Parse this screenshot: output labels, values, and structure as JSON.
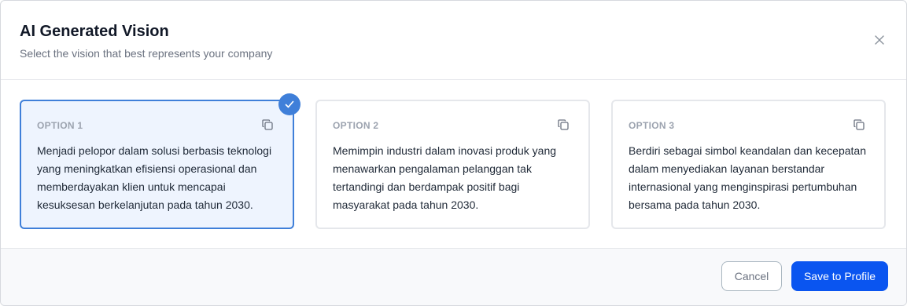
{
  "header": {
    "title": "AI Generated Vision",
    "subtitle": "Select the vision that best represents your company"
  },
  "options": [
    {
      "label": "OPTION 1",
      "text": "Menjadi pelopor dalam solusi berbasis teknologi yang meningkatkan efisiensi operasional dan memberdayakan klien untuk mencapai kesuksesan berkelanjutan pada tahun 2030.",
      "selected": true
    },
    {
      "label": "OPTION 2",
      "text": "Memimpin industri dalam inovasi produk yang menawarkan pengalaman pelanggan tak tertandingi dan berdampak positif bagi masyarakat pada tahun 2030.",
      "selected": false
    },
    {
      "label": "OPTION 3",
      "text": "Berdiri sebagai simbol keandalan dan kecepatan dalam menyediakan layanan berstandar internasional yang menginspirasi pertumbuhan bersama pada tahun 2030.",
      "selected": false
    }
  ],
  "footer": {
    "cancel_label": "Cancel",
    "save_label": "Save to Profile"
  },
  "colors": {
    "accent": "#0a55f0",
    "selected_border": "#3f7fd9",
    "selected_background": "#eef4fe"
  },
  "icons": {
    "close": "close-icon",
    "copy": "copy-icon",
    "check": "check-icon"
  }
}
